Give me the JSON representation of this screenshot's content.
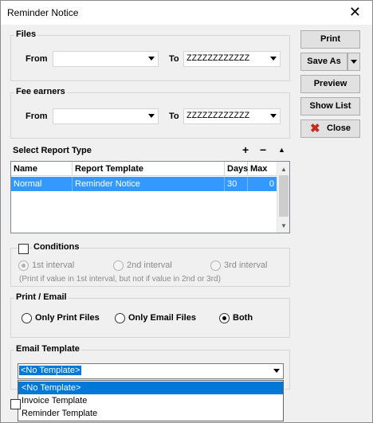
{
  "window": {
    "title": "Reminder Notice",
    "close_glyph": "✕"
  },
  "files": {
    "legend": "Files",
    "from_label": "From",
    "from_value": "",
    "to_label": "To",
    "to_value": "ZZZZZZZZZZZZ"
  },
  "fee_earners": {
    "legend": "Fee earners",
    "from_label": "From",
    "from_value": "",
    "to_label": "To",
    "to_value": "ZZZZZZZZZZZZ"
  },
  "report_type": {
    "label": "Select Report Type",
    "add_glyph": "+",
    "remove_glyph": "−",
    "up_glyph": "▲",
    "columns": [
      "Name",
      "Report Template",
      "Days",
      "Max"
    ],
    "rows": [
      {
        "name": "Normal",
        "template": "Reminder Notice",
        "days": "30",
        "max": "0"
      }
    ]
  },
  "conditions": {
    "label": "Conditions",
    "options": [
      "1st interval",
      "2nd interval",
      "3rd interval"
    ],
    "note": "(Print if value in 1st interval, but not if value in 2nd or 3rd)"
  },
  "print_email": {
    "legend": "Print / Email",
    "options": [
      "Only Print Files",
      "Only Email Files",
      "Both"
    ],
    "selected": "Both"
  },
  "email_template": {
    "legend": "Email Template",
    "value": "<No Template>",
    "options": [
      "<No Template>",
      "Invoice Template",
      "Reminder Template"
    ]
  },
  "buttons": {
    "print": "Print",
    "save_as": "Save As",
    "preview": "Preview",
    "show_list": "Show List",
    "close": "Close"
  },
  "colors": {
    "selection": "#3399ff",
    "close_icon": "#c42b1c"
  }
}
